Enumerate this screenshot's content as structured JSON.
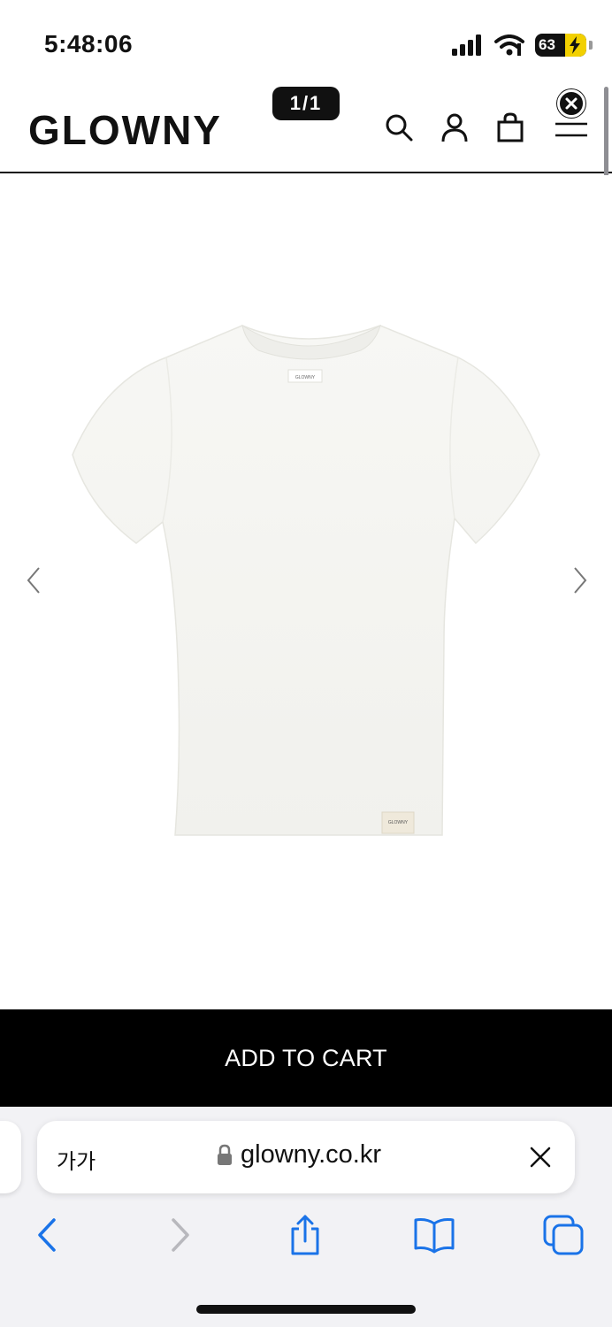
{
  "status": {
    "time": "5:48:06",
    "battery_label": "63",
    "icons": [
      "cellular-signal-icon",
      "wifi-icon",
      "battery-icon",
      "charging-bolt-icon"
    ]
  },
  "header": {
    "brand": "GLOWNY",
    "page_counter": "1/1",
    "icons": [
      "search-icon",
      "account-icon",
      "shopping-bag-icon",
      "menu-icon",
      "close-icon"
    ]
  },
  "gallery": {
    "image_label": "GLOWNY",
    "icons": [
      "chevron-left-icon",
      "chevron-right-icon"
    ]
  },
  "cart": {
    "label": "ADD TO CART"
  },
  "browser": {
    "text_size_label": "가가",
    "url": "glowny.co.kr",
    "icons": [
      "lock-icon",
      "close-icon",
      "back-icon",
      "forward-icon",
      "share-icon",
      "bookmarks-icon",
      "tabs-icon"
    ]
  },
  "colors": {
    "accent": "#000000",
    "link_blue": "#1a73e8",
    "disabled_gray": "#b8b8bd",
    "chrome_bg": "#f2f2f5"
  }
}
